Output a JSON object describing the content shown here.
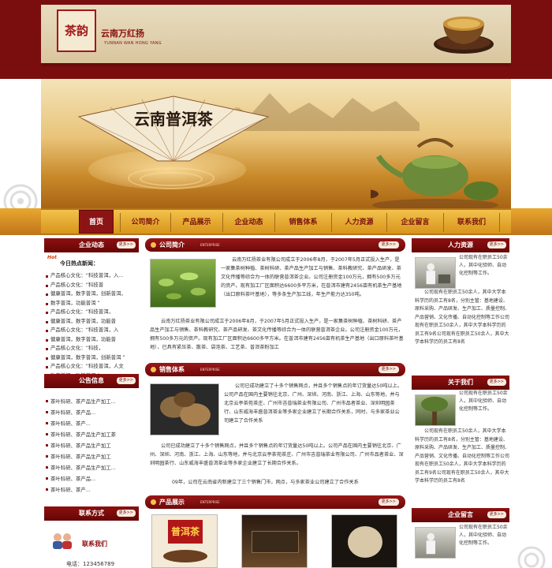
{
  "header": {
    "logo_text": "茶韵",
    "brand_name": "云南万红扬",
    "brand_en": "YUNNAN WAN HONG YANG"
  },
  "banner": {
    "fan_text": "云南普洱茶"
  },
  "nav": {
    "items": [
      "首页",
      "公司简介",
      "产品展示",
      "企业动态",
      "销售体系",
      "人力资源",
      "企业留言",
      "联系我们"
    ],
    "active": "首页"
  },
  "left": {
    "news": {
      "title": "企业动态",
      "more": "更多>>",
      "badge": "Hot",
      "headline": "今日热点新闻：",
      "items": [
        "产品核心文化：“科技普洱，入...",
        "产品核心文化：“科技普",
        "健康普洱，数字普洱，创新普洱，",
        "数字普洱，功能普洱 ”",
        "产品核心文化：“科技普洱，",
        "健康普洱，数字普洱，功能普",
        "产品核心文化：“科技普洱，入",
        "健康普洱，数字普洱，功能普",
        "产品核心文化：“科技，",
        "健康普洱，数字普洱，创新普洱 ”",
        "产品核心文化：“科技普洱，人文",
        "数字普洱，功能普洱 ”"
      ]
    },
    "notice": {
      "title": "公告信息",
      "more": "更多>>",
      "items": [
        "茶叶科研、茶产品生产加工...",
        "茶叶科研、茶产品...",
        "茶叶科研、茶产...",
        "茶叶科研、茶产品生产加工茶",
        "茶叶科研、茶产品生产加工",
        "茶叶科研、茶产品生产加工",
        "茶叶科研、茶产品生产加工...",
        "茶叶科研、茶产品...",
        "茶叶科研、茶产..."
      ]
    },
    "contact": {
      "title": "联系方式",
      "more": "更多>>",
      "label": "联系我们",
      "phone": "电话：123456789"
    }
  },
  "center": {
    "about": {
      "title": "公司简介",
      "sub": "ENTERPRISE",
      "more": "更多>>",
      "p1": "云南万红扬茶业有限公司成立于2006年8月，于2007年5月正式投入生产，是一家集茶树种植、茶树科研、茶产品生产加工与销售、茶科教研究、茶产品研发、茶文化传播等综合为一体的联营普洱茶企业。公司注册资金100万元，拥有500多万元的资产。现有加工厂区面积达6600多平方米，在普洱市建有2456亩有机茶生产基地（出口原料茶叶基地），等多条生产加工线，年生产能力达350吨。",
      "p2": "云南万红扬茶业有限公司成立于2006年8月，于2007年5月正式投入生产，是一家集茶树种植、茶树科研、茶产品生产加工与销售、茶科教研究、茶产品研发、茶文化传播等综合为一体的联营普洱茶企业。公司注册资金100万元，拥有500多万元的资产。现有加工厂区面积达6600多平方米。在普洱市建有2456亩有机茶生产基地（出口原料茶叶基地），已具有紧压茶、散茶、袋泡茶、工艺茶、普洱茶粉加工"
    },
    "sales": {
      "title": "销售体系",
      "sub": "ENTERPRISE",
      "more": "更多>>",
      "p1": "公司已成功建立了十多个销售网点，并且多个销售点的年订货量达50吨以上。公司产品在国内主要销往北京、广州、深圳、河南、浙江、上海、山东等地，并与北京云亭茶苑茶庄、广州市吉普瑞茶业有限公司、广州市品者茶业、深圳明园茶行、山东威海丰盛普洱茶业等多家企业建立了长期合作关系，同时，与多家茶业公司建立了合作关系",
      "p2": "公司已成功建立了十多个销售网点，并且多个销售点的年订货量达50吨以上。公司产品在国内主要销往北京、广州、深圳、河南、浙江、上海、山东等地，并与北京云亭茶苑茶庄、广州市吉普瑞茶业有限公司、广州市品者茶业、深圳明园茶行、山东威海丰盛普洱茶业等多家企业建立了长期合作关系。",
      "p3": "09年，公司在云南省内新建立了三个销售门市，网点，与多家茶业公司建立了合作关系"
    },
    "products": {
      "title": "产品展示",
      "sub": "ENTERPRISE",
      "more": "更多>>",
      "caption": "普洱茶"
    }
  },
  "right": {
    "hr": {
      "title": "人力资源",
      "more": "更多>>",
      "short": "公司现有在职员工50余人，其中化验师、自动化控制等工作。",
      "long": "公司现有在职员工50余人，其中大学本科学历的员工有8名，分别主管：基地建设、原料采购、产品研发、生产加工、质量控制、产品营销、文化传播、自动化控制等工作公司现有在职员工50余人，其中大学本科学历的员工有9名公司现有在职员工50余人，其中大学本科学历的员工有8名"
    },
    "about": {
      "title": "关于我们",
      "more": "更多>>",
      "short": "公司现有在职员工50余人，其中化验师、自动化控制等工作。",
      "long": "公司现有在职员工50余人，其中大学本科学历的员工有8名，分别主管：基地建设、原料采购、产品研发、生产加工、质量控制、产品营销、文化传播、自动化控制等工作公司现有在职员工50余人，其中大学本科学历的员工有9名公司现有在职员工50余人，其中大学本科学历的员工有8名"
    },
    "message": {
      "title": "企业留言",
      "more": "更多>>",
      "short": "公司现有在职员工50余人，其中化验师、自动化控制等工作。"
    }
  }
}
